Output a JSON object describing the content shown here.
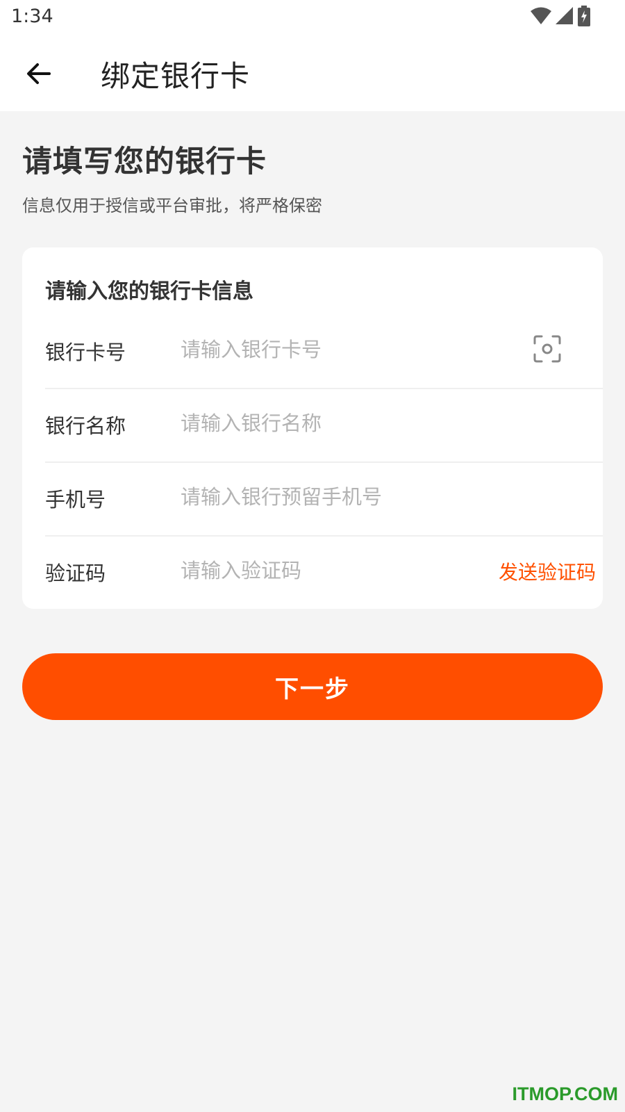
{
  "status_bar": {
    "time": "1:34"
  },
  "toolbar": {
    "title": "绑定银行卡"
  },
  "header": {
    "title": "请填写您的银行卡",
    "subtitle": "信息仅用于授信或平台审批，将严格保密"
  },
  "card": {
    "title": "请输入您的银行卡信息",
    "rows": [
      {
        "label": "银行卡号",
        "placeholder": "请输入银行卡号",
        "value": ""
      },
      {
        "label": "银行名称",
        "placeholder": "请输入银行名称",
        "value": ""
      },
      {
        "label": "手机号",
        "placeholder": "请输入银行预留手机号",
        "value": ""
      },
      {
        "label": "验证码",
        "placeholder": "请输入验证码",
        "value": ""
      }
    ],
    "send_code_label": "发送验证码"
  },
  "actions": {
    "next_label": "下一步"
  },
  "watermark": "ITMOP.COM",
  "colors": {
    "accent": "#ff4e00",
    "send_code": "#ff5000",
    "background": "#f4f4f4"
  }
}
